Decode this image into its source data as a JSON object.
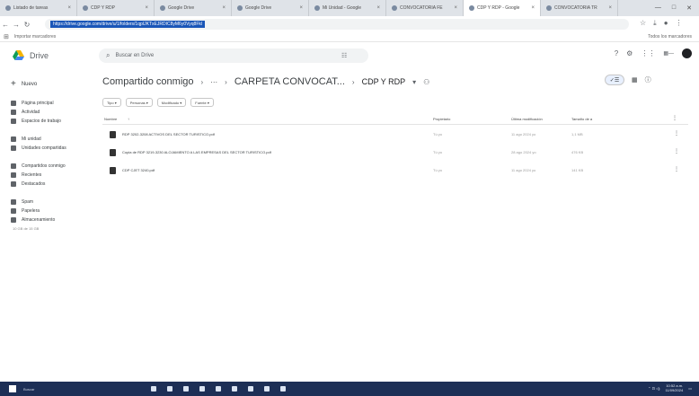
{
  "browser": {
    "tabs": [
      {
        "title": "Listado de tareas"
      },
      {
        "title": "CDP Y RDP"
      },
      {
        "title": "Google Drive"
      },
      {
        "title": "Google Drive"
      },
      {
        "title": "Mi Unidad - Google"
      },
      {
        "title": "CONVOCATORIA FE"
      },
      {
        "title": "CDP Y RDP - Google"
      },
      {
        "title": "CONVOCATORIA TR"
      }
    ],
    "url": "https://drive.google.com/drive/u/1/folders/1qpIJKTxEJRDIC8yM6y0Vyq8Fkl",
    "bookmarks_label": "Importar marcadores",
    "all_bookmarks": "Todos los marcadores",
    "window_controls": [
      "—",
      "□",
      "✕"
    ]
  },
  "drive": {
    "app_name": "Drive",
    "search_placeholder": "Buscar en Drive",
    "new_label": "Nuevo",
    "sidebar": [
      {
        "label": "Página principal"
      },
      {
        "label": "Actividad"
      },
      {
        "label": "Espacios de trabajo"
      },
      {
        "label": "Mi unidad"
      },
      {
        "label": "Unidades compartidas"
      },
      {
        "label": "Compartidos conmigo"
      },
      {
        "label": "Recientes"
      },
      {
        "label": "Destacados"
      },
      {
        "label": "Spam"
      },
      {
        "label": "Papelera"
      },
      {
        "label": "Almacenamiento"
      }
    ],
    "storage_text": "10 GB de 15 GB",
    "breadcrumb": {
      "root": "Compartido conmigo",
      "more": "···",
      "folder": "CARPETA CONVOCAT...",
      "current": "CDP Y RDP"
    },
    "filters": [
      "Tipo",
      "Personas",
      "Modificado",
      "Fuente"
    ],
    "columns": {
      "name": "Nombre",
      "owner": "Propietario",
      "modified": "Última modificación",
      "size": "Tamaño de a"
    },
    "files": [
      {
        "name": "RDP 3202-3208 ACTIVOS DEL SECTOR TURISTICO.pdf",
        "owner": "Tú yo",
        "modified": "11 ago 2024 yo",
        "size": "1,1 MB"
      },
      {
        "name": "Copia de RDP 3219-3230 ALOJAMIENTO A LAS EMPRESAS DEL SECTOR TURISTICO.pdf",
        "owner": "Tú yo",
        "modified": "28 ago 2024 yo",
        "size": "476 KB"
      },
      {
        "name": "CDP CJET 3240.pdf",
        "owner": "Tú yo",
        "modified": "11 ago 2024 yo",
        "size": "141 KB"
      }
    ]
  },
  "taskbar": {
    "search_label": "Buscar",
    "time": "10:52 a.m.",
    "date": "11/09/2024"
  }
}
